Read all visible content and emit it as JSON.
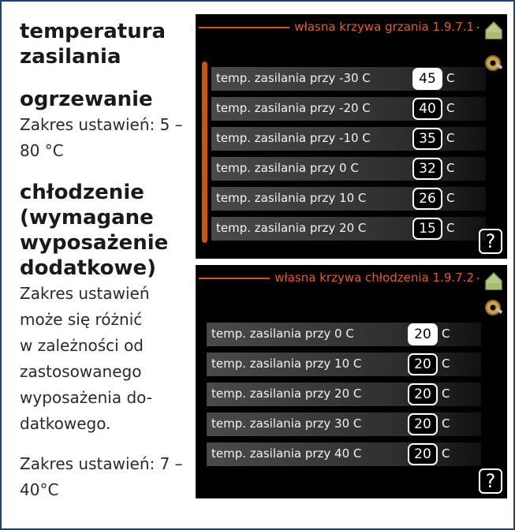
{
  "left": {
    "title": "temperatura zasilania",
    "heating_heading": "ogrzewanie",
    "heating_range": "Zakres ustawień: 5 – 80 °C",
    "cooling_heading": "chłodzenie (wymagane wyposażenie dodatkowe)",
    "cooling_note": "Zakres ustawień\nmoże się różnić\nw zależności od\nzastosowanego\nwyposażenia do-\ndatkowego.",
    "cooling_range": "Zakres ustawień: 7 – 40°C"
  },
  "heating_screen": {
    "title": "własna krzywa grzania 1.9.7.1",
    "rows": [
      {
        "label": "temp. zasilania przy -30  C",
        "value": "45",
        "unit": "C"
      },
      {
        "label": "temp. zasilania przy -20  C",
        "value": "40",
        "unit": "C"
      },
      {
        "label": "temp. zasilania przy -10  C",
        "value": "35",
        "unit": "C"
      },
      {
        "label": "temp. zasilania przy 0  C",
        "value": "32",
        "unit": "C"
      },
      {
        "label": "temp. zasilania przy 10  C",
        "value": "26",
        "unit": "C"
      },
      {
        "label": "temp. zasilania przy 20  C",
        "value": "15",
        "unit": "C"
      }
    ],
    "help": "?"
  },
  "cooling_screen": {
    "title": "własna krzywa chłodzenia 1.9.7.2",
    "rows": [
      {
        "label": "temp. zasilania przy 0  C",
        "value": "20",
        "unit": "C"
      },
      {
        "label": "temp. zasilania przy 10  C",
        "value": "20",
        "unit": "C"
      },
      {
        "label": "temp. zasilania przy 20  C",
        "value": "20",
        "unit": "C"
      },
      {
        "label": "temp. zasilania przy 30  C",
        "value": "20",
        "unit": "C"
      },
      {
        "label": "temp. zasilania przy 40  C",
        "value": "20",
        "unit": "C"
      }
    ],
    "help": "?"
  },
  "icons": {
    "home": "home-icon",
    "settings": "gear-icon",
    "help": "help-icon"
  },
  "colors": {
    "accent": "#e2601a",
    "frame": "#1f3f6e"
  }
}
